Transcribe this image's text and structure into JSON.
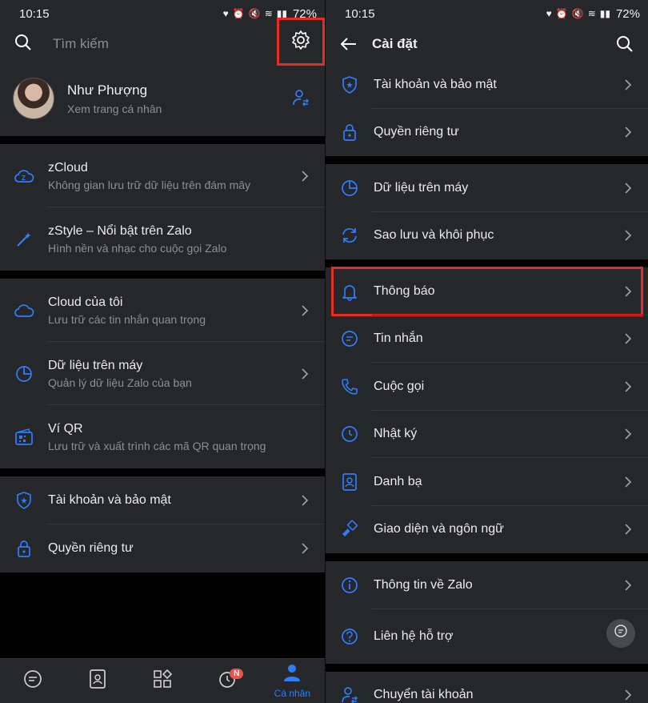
{
  "left": {
    "status": {
      "time": "10:15",
      "battery": "72%"
    },
    "search": {
      "placeholder": "Tìm kiếm"
    },
    "profile": {
      "name": "Như Phượng",
      "subtitle": "Xem trang cá nhân"
    },
    "group1": [
      {
        "title": "zCloud",
        "subtitle": "Không gian lưu trữ dữ liệu trên đám mây",
        "icon": "zcloud-icon"
      },
      {
        "title": "zStyle – Nổi bật trên Zalo",
        "subtitle": "Hình nền và nhạc cho cuộc gọi Zalo",
        "icon": "magic-wand-icon"
      }
    ],
    "group2": [
      {
        "title": "Cloud của tôi",
        "subtitle": "Lưu trữ các tin nhắn quan trọng",
        "icon": "cloud-icon"
      },
      {
        "title": "Dữ liệu trên máy",
        "subtitle": "Quản lý dữ liệu Zalo của bạn",
        "icon": "pie-chart-icon"
      },
      {
        "title": "Ví QR",
        "subtitle": "Lưu trữ và xuất trình các mã QR quan trọng",
        "icon": "qr-wallet-icon"
      }
    ],
    "group3": [
      {
        "title": "Tài khoản và bảo mật",
        "icon": "shield-icon"
      },
      {
        "title": "Quyền riêng tư",
        "icon": "lock-icon"
      }
    ],
    "nav": {
      "active_label": "Cá nhân",
      "timeline_badge": "N"
    }
  },
  "right": {
    "status": {
      "time": "10:15",
      "battery": "72%"
    },
    "title": "Cài đặt",
    "group1": [
      {
        "title": "Tài khoản và bảo mật",
        "icon": "shield-icon"
      },
      {
        "title": "Quyền riêng tư",
        "icon": "lock-icon"
      }
    ],
    "group2": [
      {
        "title": "Dữ liệu trên máy",
        "icon": "pie-chart-icon"
      },
      {
        "title": "Sao lưu và khôi phục",
        "icon": "sync-icon"
      }
    ],
    "group3": [
      {
        "title": "Thông báo",
        "icon": "bell-icon"
      },
      {
        "title": "Tin nhắn",
        "icon": "chat-icon"
      },
      {
        "title": "Cuộc gọi",
        "icon": "phone-icon"
      },
      {
        "title": "Nhật ký",
        "icon": "clock-icon"
      },
      {
        "title": "Danh bạ",
        "icon": "contacts-icon"
      },
      {
        "title": "Giao diện và ngôn ngữ",
        "icon": "paint-icon"
      }
    ],
    "group4": [
      {
        "title": "Thông tin về Zalo",
        "icon": "info-icon"
      },
      {
        "title": "Liên hệ hỗ trợ",
        "icon": "help-icon"
      }
    ],
    "group5": [
      {
        "title": "Chuyển tài khoản",
        "icon": "switch-account-icon"
      }
    ]
  },
  "colors": {
    "accent": "#2f7dfb",
    "highlight": "#e52d23",
    "surface": "#26272b"
  }
}
